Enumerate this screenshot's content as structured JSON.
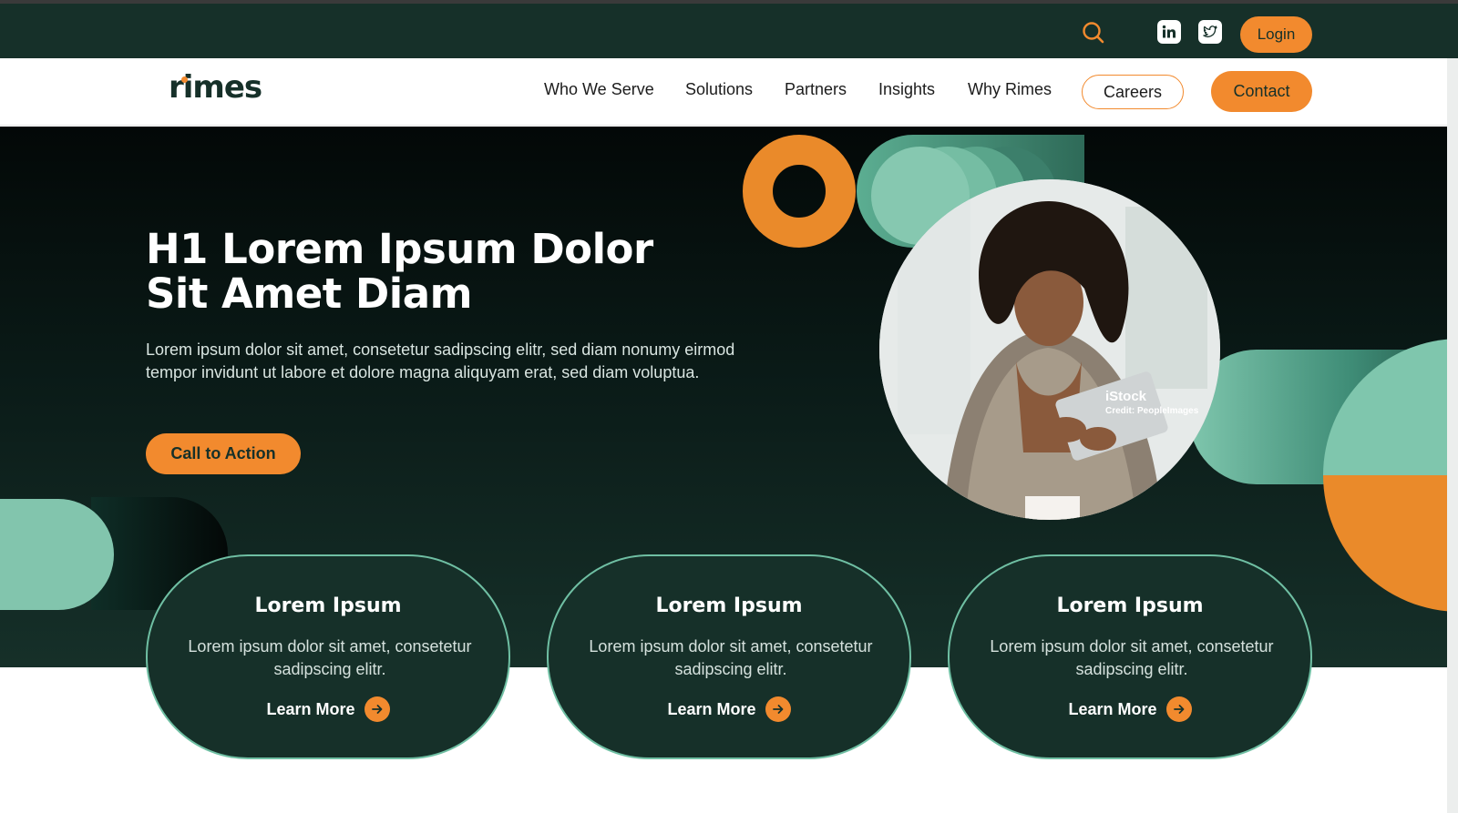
{
  "topbar": {
    "login_label": "Login"
  },
  "navbar": {
    "logo": "rimes",
    "items": [
      {
        "label": "Who We Serve"
      },
      {
        "label": "Solutions"
      },
      {
        "label": "Partners"
      },
      {
        "label": "Insights"
      },
      {
        "label": "Why Rimes"
      }
    ],
    "careers_label": "Careers",
    "contact_label": "Contact"
  },
  "hero": {
    "title_line1": "H1 Lorem Ipsum Dolor",
    "title_line2": "Sit Amet Diam",
    "body": "Lorem ipsum dolor sit amet, consetetur sadipscing elitr, sed diam nonumy eirmod tempor invidunt ut labore et dolore magna aliquyam erat, sed diam voluptua.",
    "cta_label": "Call to Action",
    "image_watermark": "iStock",
    "image_credit": "Credit: PeopleImages"
  },
  "cards": [
    {
      "title": "Lorem Ipsum",
      "text": "Lorem ipsum dolor sit amet, consetetur sadipscing elitr.",
      "link": "Learn More"
    },
    {
      "title": "Lorem Ipsum",
      "text": "Lorem ipsum dolor sit amet, consetetur sadipscing elitr.",
      "link": "Learn More"
    },
    {
      "title": "Lorem Ipsum",
      "text": "Lorem ipsum dolor sit amet, consetetur sadipscing elitr.",
      "link": "Learn More"
    }
  ],
  "icons": {
    "search": "search-icon",
    "linkedin": "linkedin-icon",
    "twitter": "twitter-icon",
    "arrow": "arrow-right-icon"
  },
  "colors": {
    "brand_dark": "#163029",
    "accent_orange": "#f28a2e",
    "accent_green": "#7fc6ad"
  }
}
